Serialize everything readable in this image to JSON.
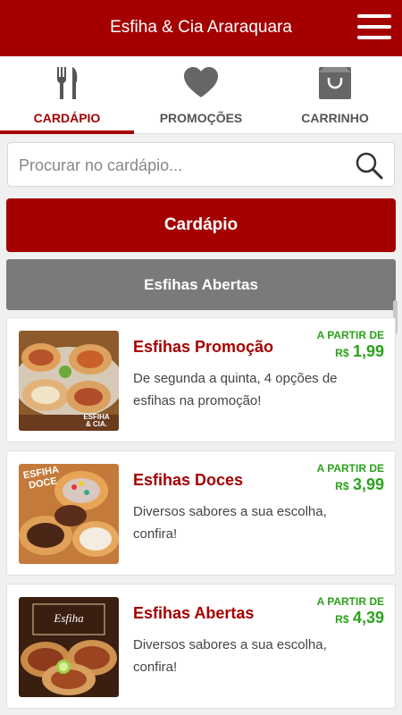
{
  "header": {
    "title": "Esfiha & Cia Araraquara"
  },
  "tabs": [
    {
      "label": "CARDÁPIO",
      "icon": "fork-knife-icon"
    },
    {
      "label": "PROMOÇÕES",
      "icon": "heart-icon"
    },
    {
      "label": "CARRINHO",
      "icon": "shopping-bag-icon"
    }
  ],
  "search": {
    "placeholder": "Procurar no cardápio...",
    "value": ""
  },
  "menu_button": "Cardápio",
  "category_button": "Esfihas Abertas",
  "products": [
    {
      "name": "Esfihas Promoção",
      "description": "De segunda a quinta, 4 opções de esfihas na promoção!",
      "from_label": "A PARTIR DE",
      "currency": "R$",
      "price": "1,99",
      "image_text": "ESFIHA & CIA."
    },
    {
      "name": "Esfihas Doces",
      "description": "Diversos sabores a sua escolha, confira!",
      "from_label": "A PARTIR DE",
      "currency": "R$",
      "price": "3,99",
      "image_text": "ESFIHA DOCE"
    },
    {
      "name": "Esfihas Abertas",
      "description": "Diversos sabores a sua escolha, confira!",
      "from_label": "A PARTIR DE",
      "currency": "R$",
      "price": "4,39",
      "image_text": "Esfiha"
    }
  ],
  "colors": {
    "brand": "#a50000",
    "price": "#2ba21b",
    "category": "#7a7a7a"
  }
}
